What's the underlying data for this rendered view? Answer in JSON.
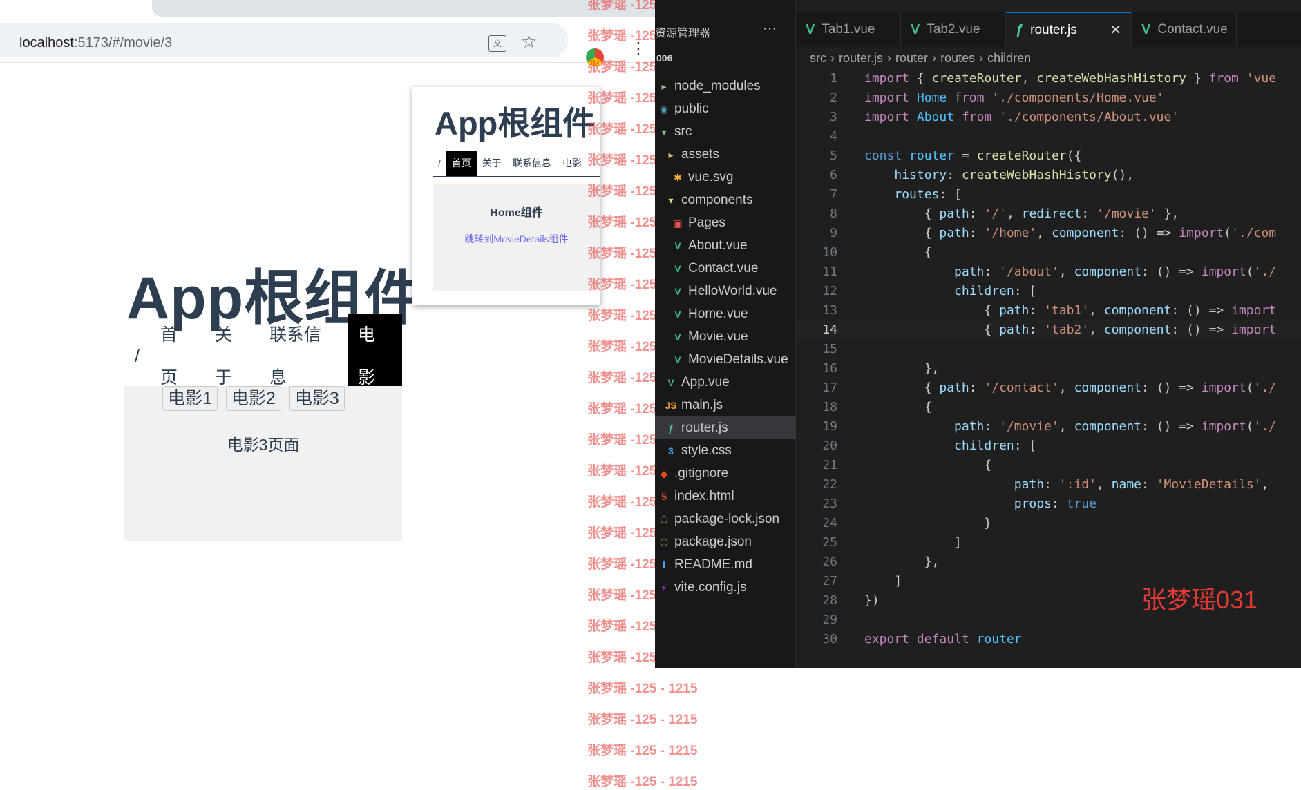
{
  "browser": {
    "url_host": "localhost",
    "url_path": ":5173/#/movie/3",
    "translate_glyph": "文",
    "star_glyph": "☆",
    "menu_glyph": "⋮"
  },
  "app": {
    "title": "App根组件",
    "nav": [
      "/",
      "首页",
      "关于",
      "联系信息",
      "电影"
    ],
    "movie_buttons": [
      "电影1",
      "电影2",
      "电影3"
    ],
    "movie_page_text": "电影3页面"
  },
  "overlay": {
    "title": "App根组件",
    "nav": [
      "/",
      "首页",
      "关于",
      "联系信息",
      "电影"
    ],
    "home_heading": "Home组件",
    "link_text": "跳转到MovieDetails组件"
  },
  "watermark": {
    "lines": [
      "张梦瑶 -125 - 1215",
      "张梦瑶 -125 - 1215",
      "张梦瑶 -125 - 1215",
      "张梦瑶 -125 - 1215",
      "张梦瑶 -125 - 1215",
      "张梦瑶 -125 - 1215",
      "张梦瑶 -125 - 1215",
      "张梦瑶 -125 - 1215",
      "张梦瑶 -125 - 1215",
      "张梦瑶 -125 - 1215",
      "张梦瑶 -125 - 1215",
      "张梦瑶 -125 - 1215",
      "张梦瑶 -125 - 1215",
      "张梦瑶 -125 - 1215",
      "张梦瑶 -125 - 1215",
      "张梦瑶 -125 - 1215",
      "张梦瑶 -125 - 1215",
      "张梦瑶 -125 - 1215",
      "张梦瑶 -125 - 1215",
      "张梦瑶 -125 - 1215",
      "张梦瑶 -125 - 1215",
      "张梦瑶 -125 - 1215",
      "张梦瑶 -125 - 1215",
      "张梦瑶 -125 - 1215",
      "张梦瑶 -125 - 1215",
      "张梦瑶 -125 - 1215"
    ]
  },
  "explorer": {
    "title": "资源管理器",
    "more": "···",
    "project": "006",
    "items": [
      {
        "label": "node_modules",
        "icon": "folder",
        "color": "#8dc891",
        "glyph": "▸",
        "indent": 0
      },
      {
        "label": "public",
        "icon": "folder-public",
        "color": "#519aba",
        "glyph": "◉",
        "indent": 0
      },
      {
        "label": "src",
        "icon": "folder-src",
        "color": "#8dc891",
        "glyph": "▾",
        "indent": 0
      },
      {
        "label": "assets",
        "icon": "folder-assets",
        "color": "#dcb67a",
        "glyph": "▸",
        "indent": 1
      },
      {
        "label": "vue.svg",
        "icon": "svg-file",
        "color": "#ffb13b",
        "glyph": "✱",
        "indent": 2
      },
      {
        "label": "components",
        "icon": "folder-components",
        "color": "#c5e478",
        "glyph": "▾",
        "indent": 1
      },
      {
        "label": "Pages",
        "icon": "folder-pages",
        "color": "#ef5350",
        "glyph": "▣",
        "indent": 2
      },
      {
        "label": "About.vue",
        "icon": "vue-file",
        "color": "#41b883",
        "glyph": "V",
        "indent": 2
      },
      {
        "label": "Contact.vue",
        "icon": "vue-file",
        "color": "#41b883",
        "glyph": "V",
        "indent": 2
      },
      {
        "label": "HelloWorld.vue",
        "icon": "vue-file",
        "color": "#41b883",
        "glyph": "V",
        "indent": 2
      },
      {
        "label": "Home.vue",
        "icon": "vue-file",
        "color": "#41b883",
        "glyph": "V",
        "indent": 2
      },
      {
        "label": "Movie.vue",
        "icon": "vue-file",
        "color": "#41b883",
        "glyph": "V",
        "indent": 2
      },
      {
        "label": "MovieDetails.vue",
        "icon": "vue-file",
        "color": "#41b883",
        "glyph": "V",
        "indent": 2
      },
      {
        "label": "App.vue",
        "icon": "vue-file",
        "color": "#41b883",
        "glyph": "V",
        "indent": 1
      },
      {
        "label": "main.js",
        "icon": "js-file",
        "color": "#f0a030",
        "glyph": "JS",
        "indent": 1
      },
      {
        "label": "router.js",
        "icon": "router-file",
        "color": "#4ec9b0",
        "glyph": "ƒ",
        "indent": 1,
        "selected": true
      },
      {
        "label": "style.css",
        "icon": "css-file",
        "color": "#42a5f5",
        "glyph": "3",
        "indent": 1
      },
      {
        "label": ".gitignore",
        "icon": "git-file",
        "color": "#e64a19",
        "glyph": "◆",
        "indent": 0
      },
      {
        "label": "index.html",
        "icon": "html-file",
        "color": "#e44d26",
        "glyph": "5",
        "indent": 0
      },
      {
        "label": "package-lock.json",
        "icon": "json-file",
        "color": "#8bc34a",
        "glyph": "⬡",
        "indent": 0
      },
      {
        "label": "package.json",
        "icon": "json-file",
        "color": "#8bc34a",
        "glyph": "⬡",
        "indent": 0
      },
      {
        "label": "README.md",
        "icon": "info-file",
        "color": "#42a5f5",
        "glyph": "ℹ",
        "indent": 0
      },
      {
        "label": "vite.config.js",
        "icon": "vite-file",
        "color": "#bd34fe",
        "glyph": "⚡",
        "indent": 0
      }
    ]
  },
  "editor": {
    "tabs": [
      {
        "label": "Tab1.vue",
        "type": "vue"
      },
      {
        "label": "Tab2.vue",
        "type": "vue"
      },
      {
        "label": "router.js",
        "type": "js",
        "active": true
      },
      {
        "label": "Contact.vue",
        "type": "vue"
      }
    ],
    "close_glyph": "✕",
    "breadcrumbs": [
      "src",
      "router.js",
      "router",
      "routes",
      "children"
    ],
    "current_line": 14,
    "code_lines": [
      "import { createRouter, createWebHashHistory } from 'vue",
      "import Home from './components/Home.vue'",
      "import About from './components/About.vue'",
      "",
      "const router = createRouter({",
      "    history: createWebHashHistory(),",
      "    routes: [",
      "        { path: '/', redirect: '/movie' },",
      "        { path: '/home', component: () => import('./com",
      "        {",
      "            path: '/about', component: () => import('./",
      "            children: [",
      "                { path: 'tab1', component: () => import",
      "                { path: 'tab2', component: () => import",
      "",
      "        },",
      "        { path: '/contact', component: () => import('./",
      "        {",
      "            path: '/movie', component: () => import('./",
      "            children: [",
      "                {",
      "                    path: ':id', name: 'MovieDetails',",
      "                    props: true",
      "                }",
      "            ]",
      "        },",
      "    ]",
      "})",
      "",
      "export default router"
    ],
    "signature": "张梦瑶031"
  }
}
